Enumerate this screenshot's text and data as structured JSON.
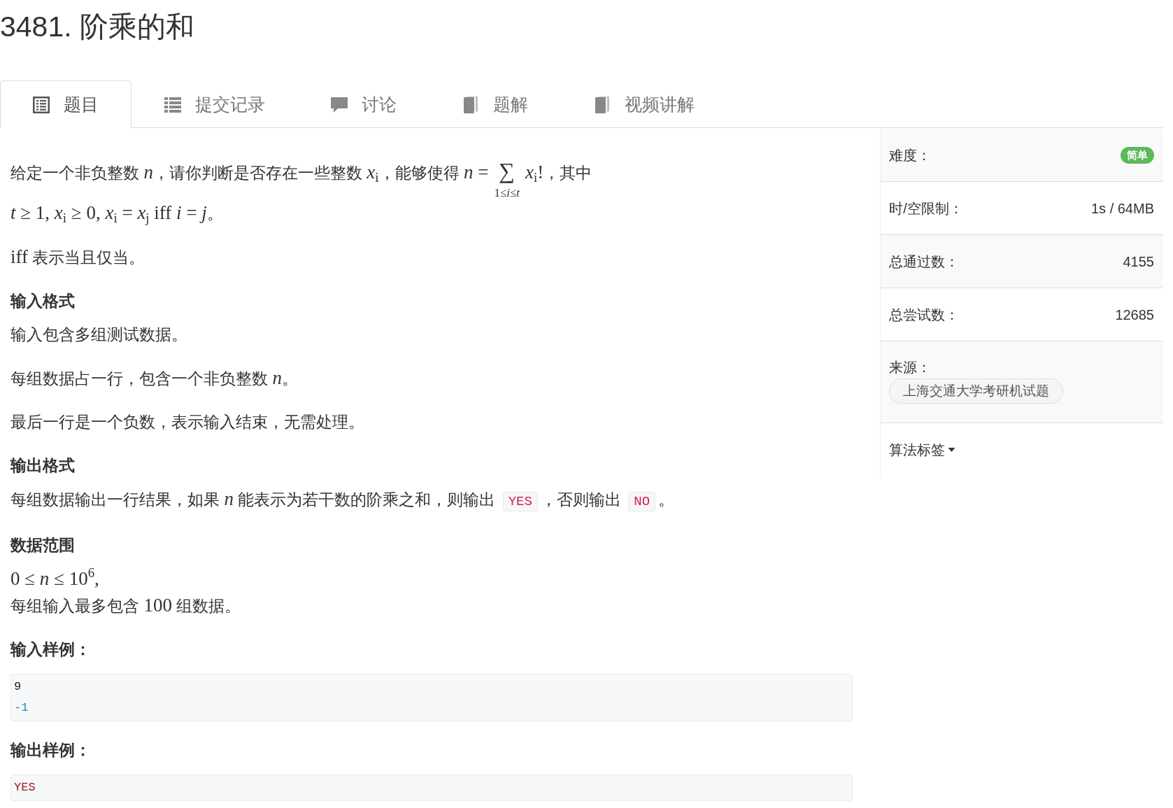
{
  "title": "3481. 阶乘的和",
  "tabs": [
    {
      "kind": "statement",
      "label": "题目",
      "selected": true
    },
    {
      "kind": "submissions",
      "label": "提交记录",
      "selected": false
    },
    {
      "kind": "discussion",
      "label": "讨论",
      "selected": false
    },
    {
      "kind": "solution",
      "label": "题解",
      "selected": false
    },
    {
      "kind": "video",
      "label": "视频讲解",
      "selected": false
    }
  ],
  "problem": {
    "blocks": [
      {
        "kind": "paragraph",
        "lines": [
          [
            {
              "kind": "text",
              "text": "给定一个非负整数 "
            },
            {
              "kind": "math",
              "text": "*n*"
            },
            {
              "kind": "text",
              "text": "，请你判断是否存在一些整数 "
            },
            {
              "kind": "math",
              "text": "*x*$_{i}$"
            },
            {
              "kind": "text",
              "text": "，能够使得 "
            },
            {
              "kind": "math",
              "text": "*n* ="
            },
            {
              "kind": "sum",
              "text": "∑",
              "lower": "1≤*i*≤*t*"
            },
            {
              "kind": "math",
              "text": "*x*$_{i}$!"
            },
            {
              "kind": "text",
              "text": "，其中"
            }
          ],
          [
            {
              "kind": "math",
              "text": "*t* ≥ 1, *x*$_{i}$ ≥ 0, *x*$_{i}$ = *x*$_{j}$ iff *i* = *j*"
            },
            {
              "kind": "text",
              "text": "。"
            }
          ]
        ]
      },
      {
        "kind": "paragraph",
        "lines": [
          [
            {
              "kind": "math",
              "text": "iff"
            },
            {
              "kind": "text",
              "text": " 表示当且仅当。"
            }
          ]
        ]
      },
      {
        "kind": "heading",
        "text": "输入格式"
      },
      {
        "kind": "paragraph",
        "lines": [
          [
            {
              "kind": "text",
              "text": "输入包含多组测试数据。"
            }
          ]
        ]
      },
      {
        "kind": "paragraph",
        "lines": [
          [
            {
              "kind": "text",
              "text": "每组数据占一行，包含一个非负整数 "
            },
            {
              "kind": "math",
              "text": "*n*"
            },
            {
              "kind": "text",
              "text": "。"
            }
          ]
        ]
      },
      {
        "kind": "paragraph",
        "lines": [
          [
            {
              "kind": "text",
              "text": "最后一行是一个负数，表示输入结束，无需处理。"
            }
          ]
        ]
      },
      {
        "kind": "heading",
        "text": "输出格式"
      },
      {
        "kind": "paragraph",
        "lines": [
          [
            {
              "kind": "text",
              "text": "每组数据输出一行结果，如果 "
            },
            {
              "kind": "math",
              "text": "*n*"
            },
            {
              "kind": "text",
              "text": " 能表示为若干数的阶乘之和，则输出 "
            },
            {
              "kind": "code",
              "text": "YES"
            },
            {
              "kind": "text",
              "text": "，否则输出 "
            },
            {
              "kind": "code",
              "text": "NO"
            },
            {
              "kind": "text",
              "text": "。"
            }
          ]
        ]
      },
      {
        "kind": "heading",
        "text": "数据范围"
      },
      {
        "kind": "paragraph",
        "lines": [
          [
            {
              "kind": "math",
              "text": "0 ≤ *n* ≤ 10$^{6}$,"
            }
          ],
          [
            {
              "kind": "text",
              "text": "每组输入最多包含 "
            },
            {
              "kind": "math",
              "text": "100"
            },
            {
              "kind": "text",
              "text": " 组数据。"
            }
          ]
        ]
      },
      {
        "kind": "heading",
        "text": "输入样例："
      },
      {
        "kind": "code",
        "lines": [
          {
            "text": "9",
            "color": "#222222"
          },
          {
            "text": "-1",
            "color": "#1d8cb4"
          }
        ]
      },
      {
        "kind": "heading",
        "text": "输出样例："
      },
      {
        "kind": "code",
        "lines": [
          {
            "text": "YES",
            "color": "#a61717"
          }
        ]
      }
    ]
  },
  "sidebar": {
    "rows": [
      {
        "kind": "badge",
        "label": "难度：",
        "value": "简单"
      },
      {
        "kind": "value",
        "label": "时/空限制：",
        "value": "1s / 64MB"
      },
      {
        "kind": "value",
        "label": "总通过数：",
        "value": "4155"
      },
      {
        "kind": "value",
        "label": "总尝试数：",
        "value": "12685"
      },
      {
        "kind": "tags",
        "label": "来源：",
        "tags": [
          "上海交通大学考研机试题"
        ]
      },
      {
        "kind": "dropdown",
        "label": "算法标签"
      }
    ]
  }
}
